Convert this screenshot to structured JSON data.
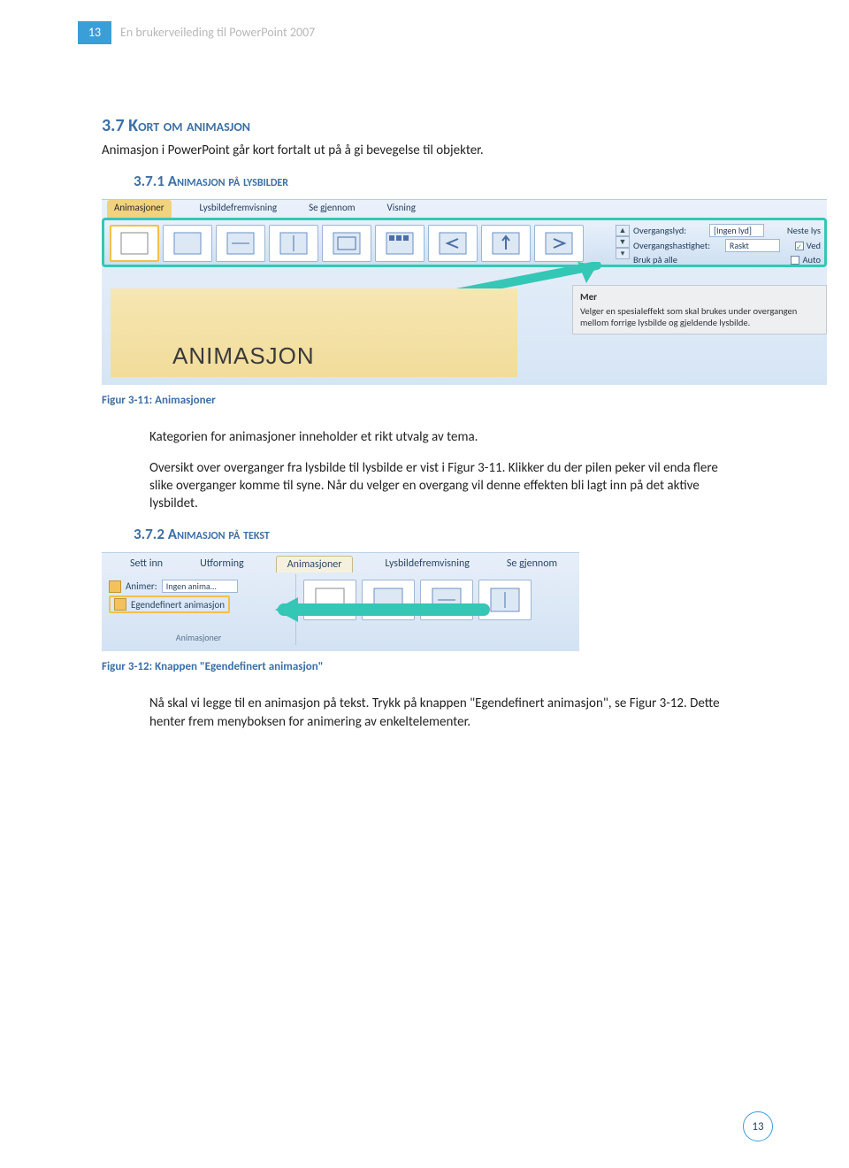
{
  "header": {
    "page_top": "13",
    "doc_title": "En brukerveileding til PowerPoint 2007"
  },
  "sec1": {
    "title": "3.7 Kort om animasjon",
    "intro": "Animasjon i PowerPoint går kort fortalt ut på å gi bevegelse til objekter."
  },
  "sub1": {
    "title": "3.7.1 Animasjon på lysbilder"
  },
  "fig311": {
    "tabs": {
      "t1": "Animasjoner",
      "t2": "Lysbildefremvisning",
      "t3": "Se gjennom",
      "t4": "Visning"
    },
    "opts": {
      "l1": "Overgangslyd:",
      "v1": "[Ingen lyd]",
      "r1": "Neste lys",
      "l2": "Overgangshastighet:",
      "v2": "Raskt",
      "r2": "Ved",
      "l3": "Bruk på alle",
      "r3": "Auto"
    },
    "slide_title": "ANIMASJON",
    "tooltip": {
      "hd": "Mer",
      "body": "Velger en spesialeffekt som skal brukes under overgangen mellom forrige lysbilde og gjeldende lysbilde."
    }
  },
  "cap311": "Figur 3-11: Animasjoner",
  "para1": "Kategorien for animasjoner inneholder et rikt utvalg av tema.",
  "para2": "Oversikt over overganger fra lysbilde til lysbilde er vist i Figur 3-11. Klikker du der pilen peker vil enda flere slike overganger komme til syne. Når du velger en overgang vil denne effekten bli lagt inn på det aktive lysbildet.",
  "sub2": {
    "title": "3.7.2 Animasjon på tekst"
  },
  "fig312": {
    "tabs": {
      "t1": "Sett inn",
      "t2": "Utforming",
      "t3": "Animasjoner",
      "t4": "Lysbildefremvisning",
      "t5": "Se gjennom"
    },
    "animer_lbl": "Animer:",
    "animer_val": "Ingen anima…",
    "egendef": "Egendefinert animasjon",
    "group": "Animasjoner"
  },
  "cap312": "Figur 3-12: Knappen \"Egendefinert animasjon\"",
  "para3": "Nå skal vi legge til en animasjon på tekst. Trykk på knappen \"Egendefinert animasjon\", se Figur 3-12. Dette henter frem menyboksen for animering av enkeltelementer.",
  "footer": {
    "num": "13"
  }
}
